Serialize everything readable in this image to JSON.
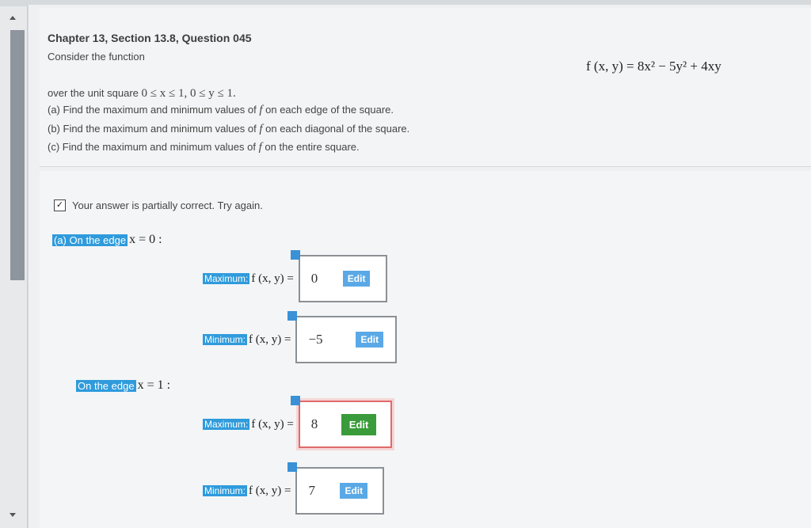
{
  "question": {
    "title": "Chapter 13, Section 13.8, Question 045",
    "consider": "Consider the function",
    "function": "f (x, y) = 8x² − 5y² + 4xy",
    "over_prefix": "over the unit square",
    "over_math": "0 ≤ x ≤ 1,  0 ≤ y ≤ 1.",
    "part_a": {
      "prefix": "(a) Find the maximum and minimum values of",
      "f": "f",
      "suffix": "on each edge of the square."
    },
    "part_b": {
      "prefix": "(b) Find the maximum and minimum values of",
      "f": "f",
      "suffix": "on each diagonal of the square."
    },
    "part_c": {
      "prefix": "(c) Find the maximum and minimum values of",
      "f": "f",
      "suffix": "on the entire square."
    }
  },
  "status": {
    "icon": "pencil-check-icon",
    "text": "Your answer is partially correct.  Try again."
  },
  "edges": [
    {
      "label": "(a) On the edge",
      "condition": "x = 0 :",
      "rows": [
        {
          "type": "Maximum:",
          "expr": "f (x, y) =",
          "value": "0",
          "edit": "Edit"
        },
        {
          "type": "Minimum:",
          "expr": "f (x, y) =",
          "value": "−5",
          "edit": "Edit"
        }
      ]
    },
    {
      "label": "On the edge",
      "condition": "x = 1 :",
      "rows": [
        {
          "type": "Maximum:",
          "expr": "f (x, y) =",
          "value": "8",
          "edit": "Edit"
        },
        {
          "type": "Minimum:",
          "expr": "f (x, y) =",
          "value": "7",
          "edit": "Edit"
        }
      ]
    }
  ],
  "colors": {
    "highlight": "#2f9bdc",
    "error_border": "#e06a6a",
    "edit_active": "#3a9b3a"
  }
}
